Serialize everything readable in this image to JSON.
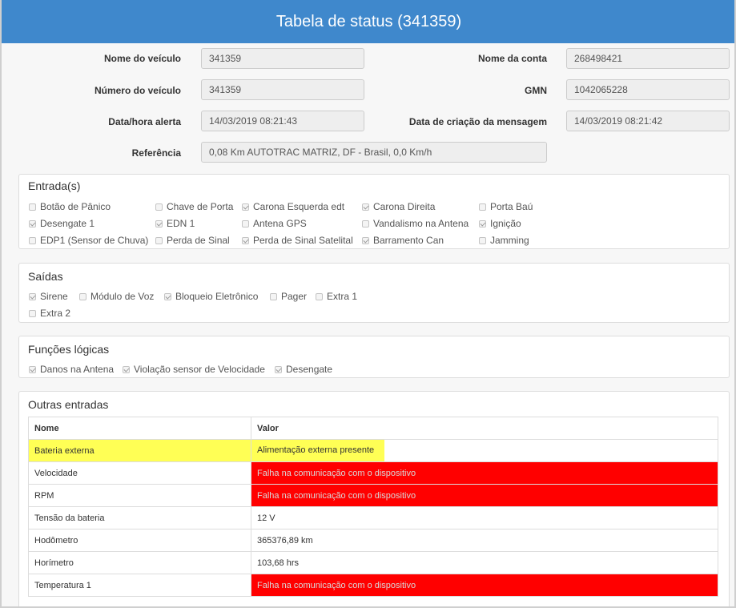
{
  "title": "Tabela de status (341359)",
  "fields": {
    "vehicle_name_label": "Nome do veículo",
    "vehicle_name": "341359",
    "account_name_label": "Nome da conta",
    "account_name": "268498421",
    "vehicle_number_label": "Número do veículo",
    "vehicle_number": "341359",
    "gmn_label": "GMN",
    "gmn": "1042065228",
    "alert_datetime_label": "Data/hora alerta",
    "alert_datetime": "14/03/2019 08:21:43",
    "message_created_label": "Data de criação da mensagem",
    "message_created": "14/03/2019 08:21:42",
    "reference_label": "Referência",
    "reference": "0,08 Km AUTOTRAC MATRIZ, DF - Brasil, 0,0 Km/h"
  },
  "inputs": {
    "title": "Entrada(s)",
    "items": [
      {
        "label": "Botão de Pânico",
        "checked": false
      },
      {
        "label": "Chave de Porta",
        "checked": false
      },
      {
        "label": "Carona Esquerda edt",
        "checked": true
      },
      {
        "label": "Carona Direita",
        "checked": true
      },
      {
        "label": "Porta Baú",
        "checked": false
      },
      {
        "label": "Desengate 1",
        "checked": true
      },
      {
        "label": "EDN 1",
        "checked": true
      },
      {
        "label": "Antena GPS",
        "checked": false
      },
      {
        "label": "Vandalismo na Antena",
        "checked": false
      },
      {
        "label": "Ignição",
        "checked": true
      },
      {
        "label": "EDP1 (Sensor de Chuva)",
        "checked": false
      },
      {
        "label": "Perda de Sinal",
        "checked": false
      },
      {
        "label": "Perda de Sinal Satelital",
        "checked": true
      },
      {
        "label": "Barramento Can",
        "checked": true
      },
      {
        "label": "Jamming",
        "checked": false
      }
    ]
  },
  "outputs": {
    "title": "Saídas",
    "items": [
      {
        "label": "Sirene",
        "checked": true
      },
      {
        "label": "Módulo de Voz",
        "checked": false
      },
      {
        "label": "Bloqueio Eletrônico",
        "checked": true
      },
      {
        "label": "Pager",
        "checked": false
      },
      {
        "label": "Extra 1",
        "checked": false
      },
      {
        "label": "Extra 2",
        "checked": false
      }
    ]
  },
  "logic": {
    "title": "Funções lógicas",
    "items": [
      {
        "label": "Danos na Antena",
        "checked": true
      },
      {
        "label": "Violação sensor de Velocidade",
        "checked": true
      },
      {
        "label": "Desengate",
        "checked": true
      }
    ]
  },
  "other": {
    "title": "Outras entradas",
    "col_name": "Nome",
    "col_value": "Valor",
    "rows": [
      {
        "name": "Bateria externa",
        "value": "Alimentação externa presente",
        "status": "highlight"
      },
      {
        "name": "Velocidade",
        "value": "Falha na comunicação com o dispositivo",
        "status": "error"
      },
      {
        "name": "RPM",
        "value": "Falha na comunicação com o dispositivo",
        "status": "error"
      },
      {
        "name": "Tensão da bateria",
        "value": "12 V",
        "status": "normal"
      },
      {
        "name": "Hodômetro",
        "value": "365376,89 km",
        "status": "normal"
      },
      {
        "name": "Horímetro",
        "value": "103,68 hrs",
        "status": "normal"
      },
      {
        "name": "Temperatura 1",
        "value": "Falha na comunicação com o dispositivo",
        "status": "error"
      }
    ]
  },
  "colors": {
    "header": "#3f88cc",
    "highlight": "#ffff55",
    "error": "#ff0000"
  }
}
